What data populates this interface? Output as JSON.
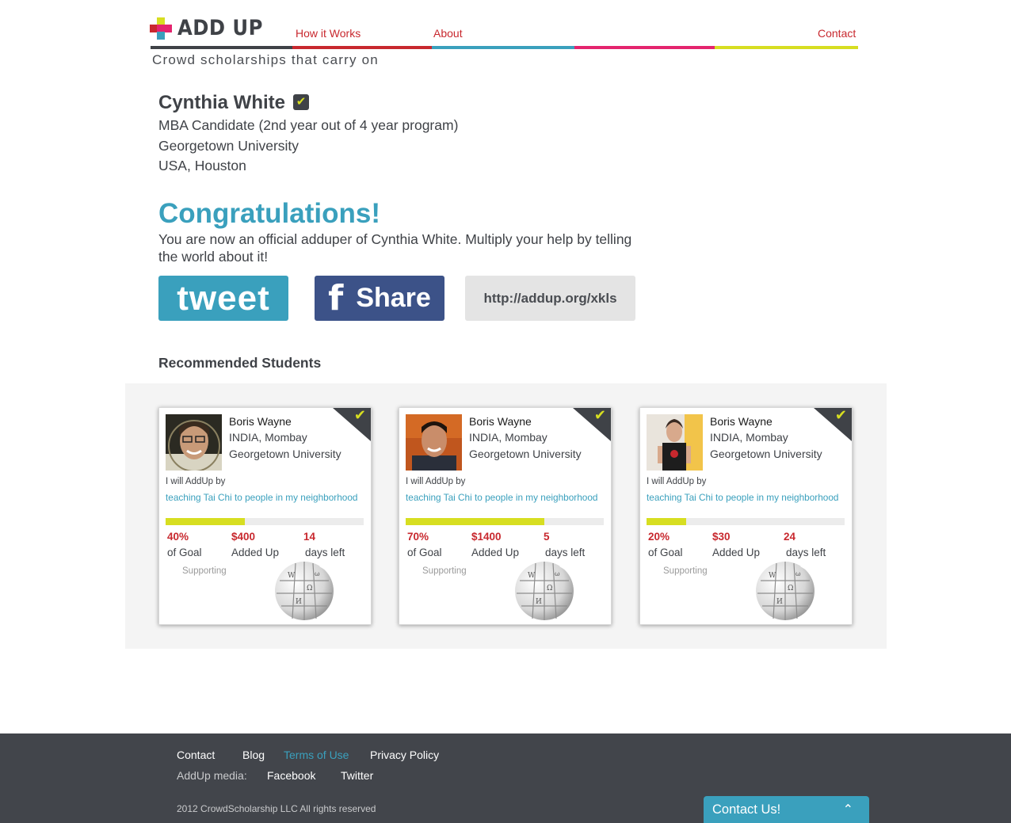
{
  "header": {
    "logo_text": "ADD UP",
    "tagline": "Crowd scholarships that carry on",
    "nav": {
      "how_it_works": "How it Works",
      "about": "About",
      "contact": "Contact"
    },
    "colors": {
      "dark": "#3f4247",
      "red": "#c8282e",
      "teal": "#3aa0bd",
      "pink": "#e4246e",
      "lime": "#d7de21"
    }
  },
  "profile": {
    "name": "Cynthia White",
    "verified_icon": "check-badge-icon",
    "program": "MBA Candidate (2nd year out of 4 year program)",
    "university": "Georgetown University",
    "location": "USA, Houston"
  },
  "congrats": {
    "title": "Congratulations!",
    "message": "You are now an official adduper of Cynthia White. Multiply your help by telling the world about it!"
  },
  "share": {
    "tweet_label": "tweet",
    "facebook_icon": "f",
    "facebook_label": "Share",
    "url": "http://addup.org/xkls"
  },
  "recommended": {
    "title": "Recommended Students",
    "cards": [
      {
        "name": "Boris Wayne",
        "location": "INDIA, Mombay",
        "university": "Georgetown University",
        "pledge_label": "I will AddUp by",
        "activity": "teaching Tai Chi to people in my neighborhood",
        "progress": 0.4,
        "goal_pct": "40%",
        "goal_label": "of Goal",
        "amount": "$400",
        "amount_label": "Added Up",
        "days": "14",
        "days_label": "days left",
        "supporting_label": "Supporting"
      },
      {
        "name": "Boris Wayne",
        "location": "INDIA, Mombay",
        "university": "Georgetown University",
        "pledge_label": "I will AddUp by",
        "activity": "teaching Tai Chi to people in my neighborhood",
        "progress": 0.7,
        "goal_pct": "70%",
        "goal_label": "of Goal",
        "amount": "$1400",
        "amount_label": "Added Up",
        "days": "5",
        "days_label": "days left",
        "supporting_label": "Supporting"
      },
      {
        "name": "Boris Wayne",
        "location": "INDIA, Mombay",
        "university": "Georgetown University",
        "pledge_label": "I will AddUp by",
        "activity": "teaching Tai Chi to people in my neighborhood",
        "progress": 0.2,
        "goal_pct": "20%",
        "goal_label": "of Goal",
        "amount": "$30",
        "amount_label": "Added Up",
        "days": "24",
        "days_label": "days left",
        "supporting_label": "Supporting"
      }
    ]
  },
  "footer": {
    "links": {
      "contact": "Contact",
      "blog": "Blog",
      "terms": "Terms of Use",
      "privacy": "Privacy Policy"
    },
    "media_label": "AddUp media:",
    "facebook": "Facebook",
    "twitter": "Twitter",
    "copyright": "2012 CrowdScholarship LLC All rights reserved",
    "contact_tab": "Contact Us!",
    "contact_tab_icon": "chevron-up-icon"
  }
}
